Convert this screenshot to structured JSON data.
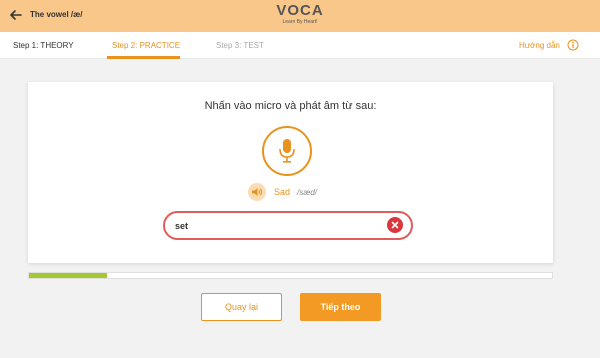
{
  "header": {
    "lesson_title": "The vowel /æ/",
    "logo_text": "VOCA",
    "logo_tagline": "Learn By Heart!",
    "back_icon": "arrow-left-icon",
    "background_color": "#f9c78a"
  },
  "steps": {
    "items": [
      {
        "label": "Step 1: THEORY",
        "state": "done"
      },
      {
        "label": "Step 2: PRACTICE",
        "state": "active"
      },
      {
        "label": "Step 3: TEST",
        "state": "upcoming"
      }
    ],
    "help_label": "Hướng dẫn",
    "help_icon": "info-icon",
    "accent_color": "#e8931e"
  },
  "exercise": {
    "instruction": "Nhấn vào micro và phát âm từ sau:",
    "mic_icon": "microphone-icon",
    "speaker_icon": "speaker-icon",
    "word": "Sad",
    "ipa": "/sæd/",
    "answer_value": "set",
    "answer_state": "incorrect",
    "clear_icon": "close-icon",
    "error_color": "#e35a5a"
  },
  "progress": {
    "fraction": 0.15,
    "fill_color": "#a4c82e"
  },
  "buttons": {
    "back_label": "Quay lại",
    "next_label": "Tiếp theo"
  }
}
